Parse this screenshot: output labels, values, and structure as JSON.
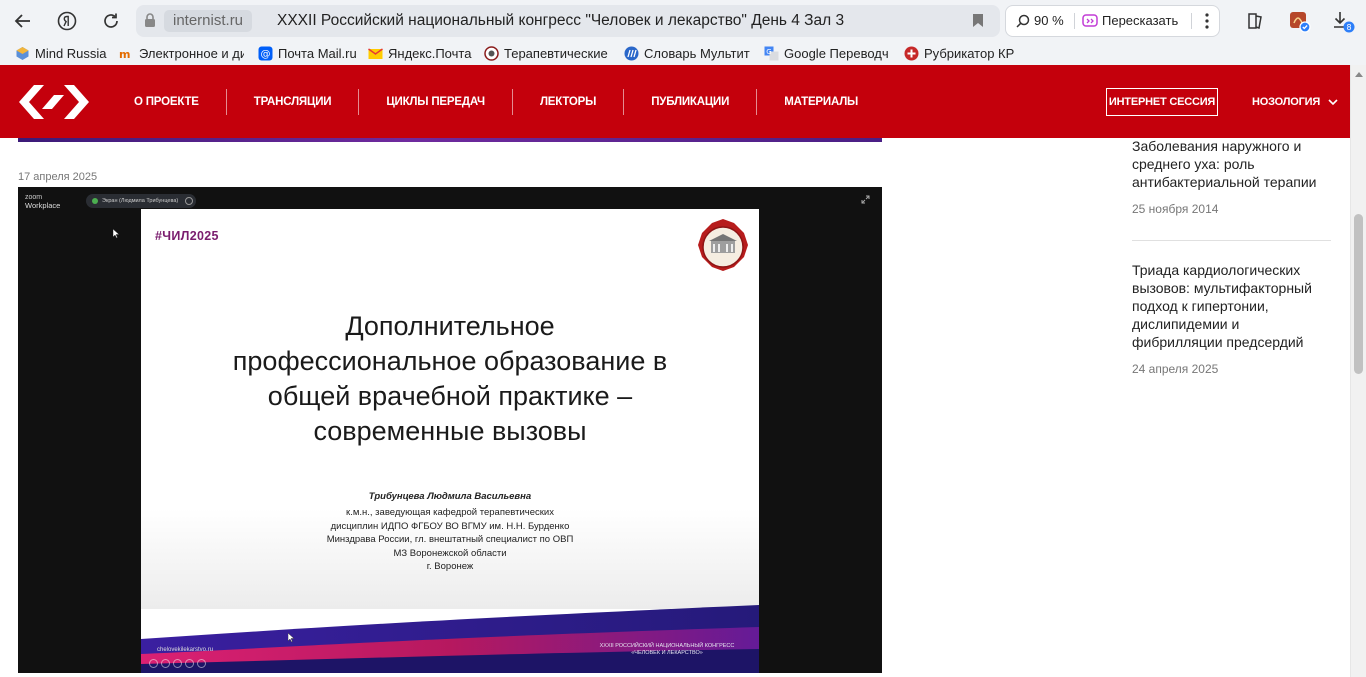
{
  "browser": {
    "domain": "internist.ru",
    "title": "XXXII Российский национальный конгресс \"Человек и лекарство\" День 4 Зал 3",
    "zoom": "90 %",
    "retell_label": "Пересказать",
    "downloads_badge": "8"
  },
  "bookmarks": [
    {
      "label": "Mind Russia",
      "icon": "mind-russia-icon"
    },
    {
      "label": "Электронное и ди",
      "icon": "edu-icon"
    },
    {
      "label": "Почта Mail.ru",
      "icon": "mail-icon"
    },
    {
      "label": "Яндекс.Почта",
      "icon": "yandex-mail-icon"
    },
    {
      "label": "Терапевтические",
      "icon": "therapy-icon"
    },
    {
      "label": "Словарь Мультит",
      "icon": "multitran-icon"
    },
    {
      "label": "Google Переводч",
      "icon": "translate-icon"
    },
    {
      "label": "Рубрикатор КР",
      "icon": "rubricator-icon"
    }
  ],
  "site": {
    "nav": [
      "О ПРОЕКТЕ",
      "ТРАНСЛЯЦИИ",
      "ЦИКЛЫ ПЕРЕДАЧ",
      "ЛЕКТОРЫ",
      "ПУБЛИКАЦИИ",
      "МАТЕРИАЛЫ"
    ],
    "session_button": "ИНТЕРНЕТ СЕССИЯ",
    "nozology": "НОЗОЛОГИЯ",
    "brand_color": "#c4000c"
  },
  "post": {
    "date": "17 апреля 2025"
  },
  "video": {
    "zoom_brand_small": "zoom",
    "zoom_brand": "Workplace",
    "share_text": "Экран (Людмила Трибунцева)"
  },
  "slide": {
    "hashtag": "#ЧИЛ2025",
    "title_lines": [
      "Дополнительное",
      "профессиональное образование в",
      "общей врачебной практике –",
      "современные вызовы"
    ],
    "author": "Трибунцева Людмила Васильевна",
    "info_lines": [
      "к.м.н., заведующая  кафедрой терапевтических",
      "дисциплин ИДПО ФГБОУ ВО ВГМУ им. Н.Н. Бурденко",
      "Минздрава России, гл. внештатный специалист по ОВП",
      "МЗ Воронежской области",
      "г. Воронеж"
    ],
    "site": "chelovekilekarstvo.ru",
    "congress_lines": [
      "XXXII РОССИЙСКИЙ НАЦИОНАЛЬНЫЙ КОНГРЕСС",
      "«ЧЕЛОВЕК И ЛЕКАРСТВО»"
    ]
  },
  "sidebar": {
    "items": [
      {
        "title": "Заболевания наружного и среднего уха: роль антибактериальной терапии",
        "date": "25 ноября 2014"
      },
      {
        "title": "Триада кардиологических вызовов: мультифакторный подход к гипертонии, дислипидемии и фибрилляции предсердий",
        "date": "24 апреля 2025"
      }
    ]
  }
}
